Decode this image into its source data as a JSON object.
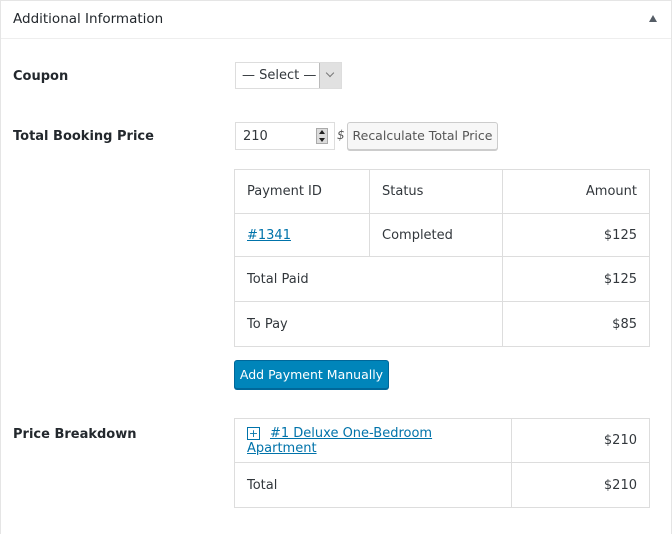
{
  "panel": {
    "title": "Additional Information",
    "toggle_icon": "triangle-up"
  },
  "coupon": {
    "label": "Coupon",
    "selected": "— Select —"
  },
  "total_price": {
    "label": "Total Booking Price",
    "value": "210",
    "currency": "$",
    "recalculate_label": "Recalculate Total Price"
  },
  "payments": {
    "headers": [
      "Payment ID",
      "Status",
      "Amount"
    ],
    "rows": [
      {
        "id": "#1341",
        "status": "Completed",
        "amount": "$125"
      }
    ],
    "total_paid_label": "Total Paid",
    "total_paid": "$125",
    "to_pay_label": "To Pay",
    "to_pay": "$85",
    "add_payment_label": "Add Payment Manually"
  },
  "breakdown": {
    "label": "Price Breakdown",
    "items": [
      {
        "name": "#1 Deluxe One-Bedroom Apartment",
        "price": "$210",
        "expand_icon": "+"
      }
    ],
    "total_label": "Total",
    "total": "$210"
  }
}
